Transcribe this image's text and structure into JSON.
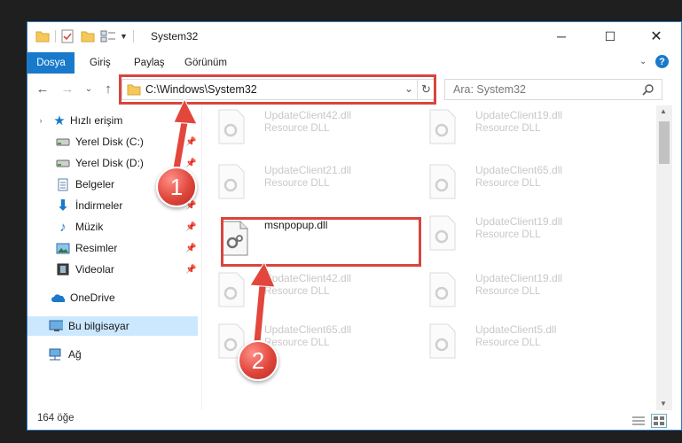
{
  "window": {
    "title": "System32"
  },
  "ribbon": {
    "tabs": [
      "Dosya",
      "Giriş",
      "Paylaş",
      "Görünüm"
    ]
  },
  "address": {
    "path": "C:\\Windows\\System32"
  },
  "search": {
    "placeholder": "Ara: System32"
  },
  "sidebar": {
    "items": [
      {
        "label": "Hızlı erişim",
        "icon": "star-icon",
        "pinned": false
      },
      {
        "label": "Yerel Disk (C:)",
        "icon": "drive-icon",
        "pinned": true
      },
      {
        "label": "Yerel Disk (D:)",
        "icon": "drive-icon",
        "pinned": true
      },
      {
        "label": "Belgeler",
        "icon": "documents-icon",
        "pinned": true
      },
      {
        "label": "İndirmeler",
        "icon": "download-icon",
        "pinned": true
      },
      {
        "label": "Müzik",
        "icon": "music-icon",
        "pinned": true
      },
      {
        "label": "Resimler",
        "icon": "pictures-icon",
        "pinned": true
      },
      {
        "label": "Videolar",
        "icon": "videos-icon",
        "pinned": true
      },
      {
        "label": "OneDrive",
        "icon": "cloud-icon",
        "pinned": false
      },
      {
        "label": "Bu bilgisayar",
        "icon": "computer-icon",
        "pinned": false,
        "selected": true
      },
      {
        "label": "Ağ",
        "icon": "network-icon",
        "pinned": false
      }
    ]
  },
  "files": [
    {
      "name": "UpdateClient42.dll",
      "type": "Resource DLL"
    },
    {
      "name": "UpdateClient19.dll",
      "type": "Resource DLL"
    },
    {
      "name": "UpdateClient21.dll",
      "type": "Resource DLL"
    },
    {
      "name": "UpdateClient65.dll",
      "type": "Resource DLL"
    },
    {
      "name": "msnpopup.dll",
      "type": ""
    },
    {
      "name": "UpdateClient19.dll",
      "type": "Resource DLL"
    },
    {
      "name": "UpdateClient42.dll",
      "type": "Resource DLL"
    },
    {
      "name": "UpdateClient19.dll",
      "type": "Resource DLL"
    },
    {
      "name": "UpdateClient65.dll",
      "type": "Resource DLL"
    },
    {
      "name": "UpdateClient5.dll",
      "type": "Resource DLL"
    }
  ],
  "status": {
    "count": "164 öğe"
  },
  "callouts": [
    "1",
    "2"
  ],
  "colors": {
    "accent": "#1979ca",
    "highlight": "#d8453e",
    "selected_bg": "#cce8ff"
  }
}
